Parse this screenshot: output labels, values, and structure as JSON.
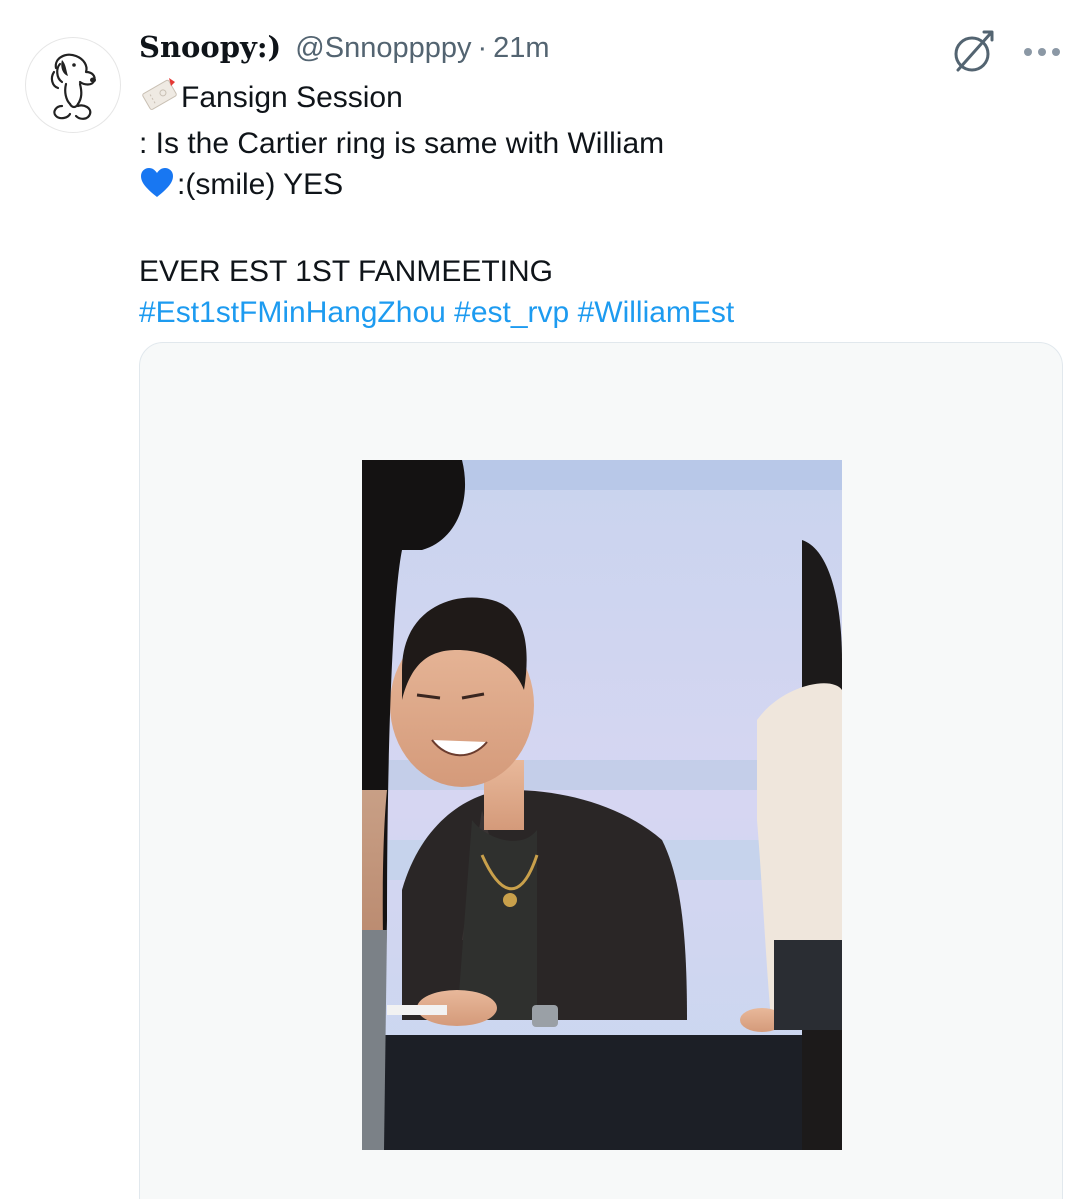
{
  "tweet": {
    "author": {
      "display_name": "Snoopy:)",
      "handle": "@Snnoppppy",
      "separator": "·",
      "time": "21m",
      "avatar_icon": "snoopy-avatar-icon"
    },
    "text_lines": {
      "line1": "Fansign Session",
      "line2": ": Is the Cartier ring is same with William",
      "line3": ":(smile) YES",
      "line4": "EVER EST 1ST FANMEETING"
    },
    "hashtags": [
      "#Est1stFMinHangZhou",
      "#est_rvp",
      "#WilliamEst"
    ],
    "emojis": [
      "ticket-emoji",
      "blue-heart-emoji"
    ],
    "icons": [
      "muted-icon",
      "more-icon"
    ],
    "colors": {
      "link": "#1d9bf0",
      "text": "#0f1419",
      "secondary": "#536471",
      "heart": "#1877f2"
    },
    "media": {
      "type": "photo"
    }
  }
}
